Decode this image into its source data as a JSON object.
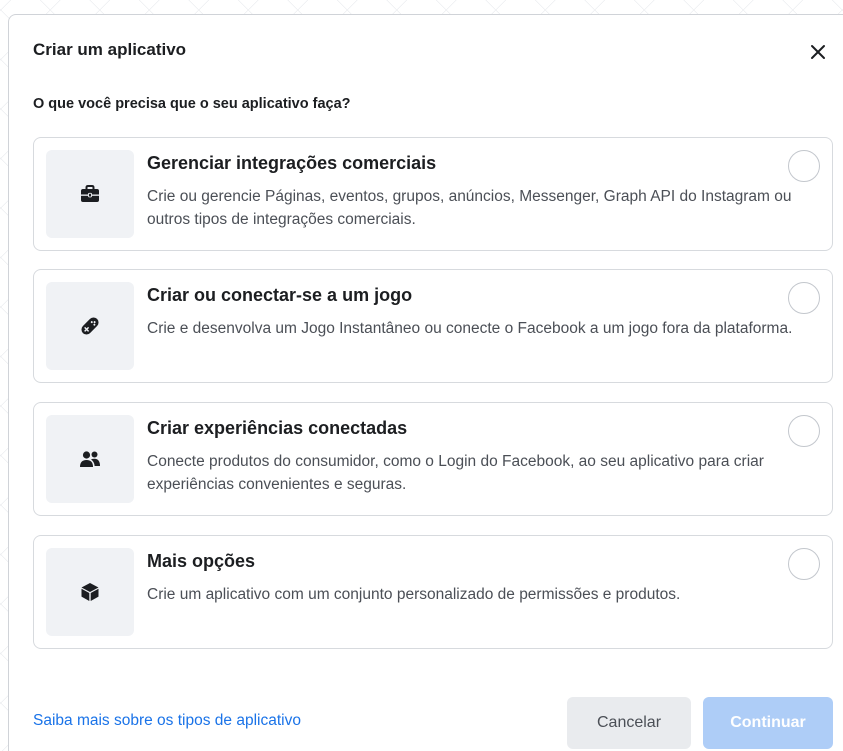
{
  "dialog": {
    "title": "Criar um aplicativo",
    "question": "O que você precisa que o seu aplicativo faça?",
    "close_icon": "close-icon"
  },
  "options": [
    {
      "title": "Gerenciar integrações comerciais",
      "description": "Crie ou gerencie Páginas, eventos, grupos, anúncios, Messenger, Graph API do Instagram ou outros tipos de integrações comerciais.",
      "icon": "briefcase-icon",
      "selected": false
    },
    {
      "title": "Criar ou conectar-se a um jogo",
      "description": "Crie e desenvolva um Jogo Instantâneo ou conecte o Facebook a um jogo fora da plataforma.",
      "icon": "gamepad-icon",
      "selected": false
    },
    {
      "title": "Criar experiências conectadas",
      "description": "Conecte produtos do consumidor, como o Login do Facebook, ao seu aplicativo para criar experiências convenientes e seguras.",
      "icon": "people-icon",
      "selected": false
    },
    {
      "title": "Mais opções",
      "description": "Crie um aplicativo com um conjunto personalizado de permissões e produtos.",
      "icon": "cube-icon",
      "selected": false
    }
  ],
  "footer": {
    "learn_more_link": "Saiba mais sobre os tipos de aplicativo",
    "cancel_label": "Cancelar",
    "continue_label": "Continuar",
    "continue_disabled": true
  },
  "colors": {
    "link": "#1a73e8",
    "continue_disabled_bg": "#aecdf7",
    "cancel_bg": "#e9ebee",
    "icon_tile_bg": "#f0f2f5"
  }
}
